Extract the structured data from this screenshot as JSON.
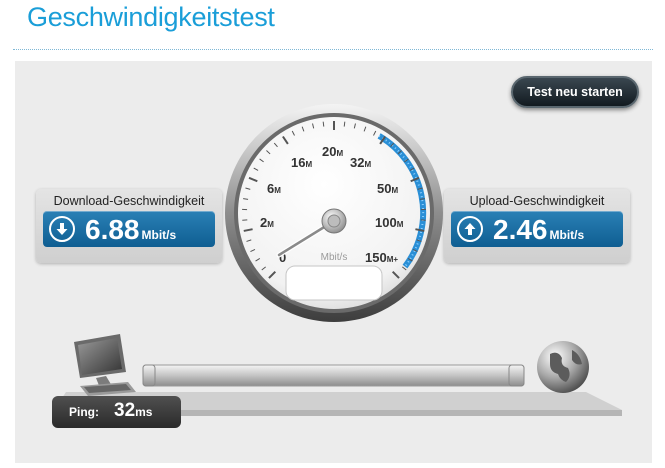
{
  "page": {
    "title": "Geschwindigkeitstest"
  },
  "toolbar": {
    "restart_label": "Test neu starten"
  },
  "download": {
    "label": "Download-Geschwindigkeit",
    "value": "6.88",
    "unit": "Mbit/s"
  },
  "upload": {
    "label": "Upload-Geschwindigkeit",
    "value": "2.46",
    "unit": "Mbit/s"
  },
  "gauge": {
    "unit_label": "Mbit/s",
    "scale": [
      {
        "num": "0",
        "suffix": ""
      },
      {
        "num": "2",
        "suffix": "M"
      },
      {
        "num": "6",
        "suffix": "M"
      },
      {
        "num": "16",
        "suffix": "M"
      },
      {
        "num": "20",
        "suffix": "M"
      },
      {
        "num": "32",
        "suffix": "M"
      },
      {
        "num": "50",
        "suffix": "M"
      },
      {
        "num": "100",
        "suffix": "M"
      },
      {
        "num": "150",
        "suffix": "M+"
      }
    ],
    "accent_color": "#2a8fd6"
  },
  "ping": {
    "label": "Ping:",
    "value": "32",
    "unit": "ms"
  },
  "colors": {
    "title": "#1a9ed8",
    "speed_bar": "#1a6fa6"
  },
  "icons": {
    "download": "arrow-down-icon",
    "upload": "arrow-up-icon",
    "computer": "computer-icon",
    "globe": "globe-icon"
  }
}
